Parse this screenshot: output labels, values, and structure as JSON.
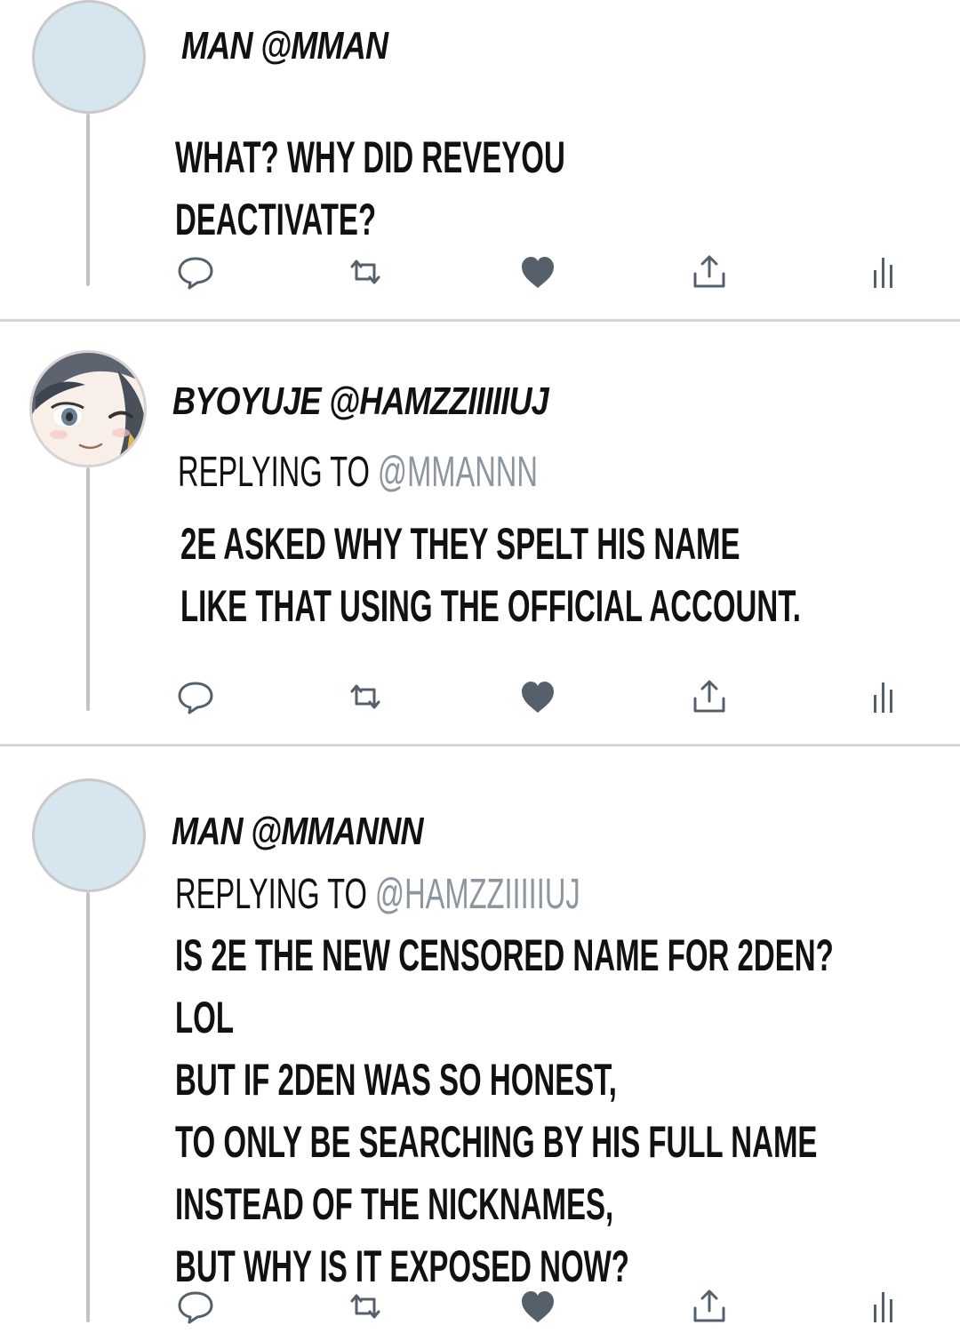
{
  "tweets": [
    {
      "display_name": "MAN",
      "username": "@MMAN",
      "replying_label": "",
      "replying_handle": "",
      "body": [
        "WHAT? WHY DID REVEYOU",
        "DEACTIVATE?"
      ],
      "avatar": "blank-avatar"
    },
    {
      "display_name": "BYOYUJE",
      "username": "@HAMZZIIIIIUJ",
      "replying_label": "REPLYING TO",
      "replying_handle": "@MMANNN",
      "body": [
        "2E ASKED WHY THEY SPELT HIS NAME",
        "LIKE THAT USING THE OFFICIAL ACCOUNT."
      ],
      "avatar": "illustrated-avatar"
    },
    {
      "display_name": "MAN",
      "username": "@MMANNN",
      "replying_label": "REPLYING TO",
      "replying_handle": "@HAMZZIIIIIUJ",
      "body": [
        "IS 2E THE NEW CENSORED NAME FOR 2DEN?",
        "LOL",
        "BUT IF 2DEN WAS SO HONEST,",
        "TO ONLY BE SEARCHING BY HIS FULL NAME",
        "INSTEAD OF THE NICKNAMES,",
        "BUT WHY IS IT EXPOSED NOW?"
      ],
      "avatar": "blank-avatar"
    }
  ],
  "action_icons": [
    "reply-icon",
    "retweet-icon",
    "like-icon",
    "share-icon",
    "analytics-icon"
  ],
  "colors": {
    "avatar_fill": "#d6e6ef",
    "thread_line": "#c3c3c3",
    "divider": "#d4d4d4",
    "icon": "#56606b",
    "handle": "#8e969d"
  }
}
